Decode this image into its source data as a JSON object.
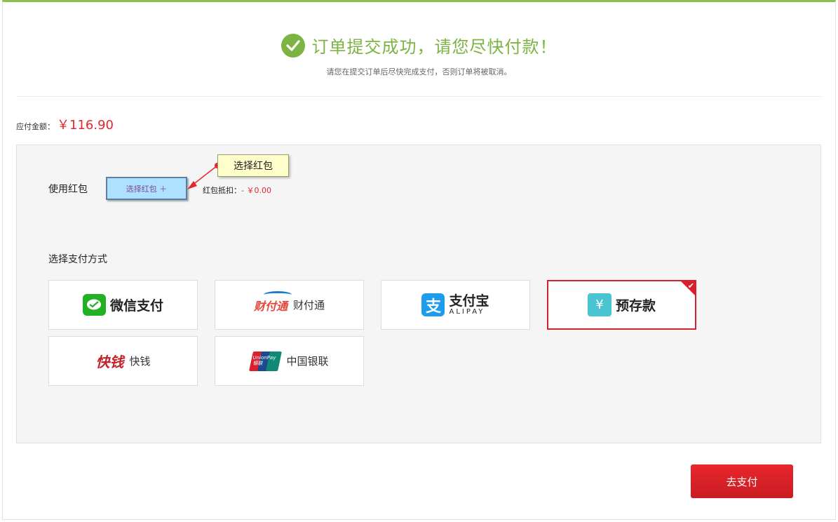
{
  "header": {
    "title": "订单提交成功，请您尽快付款！",
    "subtitle": "请您在提交订单后尽快完成支付，否则订单将被取消。"
  },
  "amount": {
    "label": "应付金额：",
    "value": "￥116.90"
  },
  "red_packet": {
    "label": "使用红包",
    "button": "选择红包 ＋",
    "deduct_label": "红包抵扣：",
    "deduct_value": "- ￥0.00",
    "tooltip": "选择红包"
  },
  "payment": {
    "label": "选择支付方式",
    "methods": [
      {
        "name": "微信支付",
        "icon": "wechat-pay-icon",
        "selected": false
      },
      {
        "name": "财付通",
        "logo_text": "财付通",
        "icon": "tenpay-logo",
        "selected": false
      },
      {
        "name": "支付宝",
        "sub": "ALIPAY",
        "icon": "alipay-icon",
        "selected": false
      },
      {
        "name": "预存款",
        "icon": "deposit-icon",
        "selected": true
      },
      {
        "name": "快钱",
        "logo_text": "快钱",
        "icon": "99bill-logo",
        "selected": false
      },
      {
        "name": "中国银联",
        "logo_text": "UnionPay 银联",
        "icon": "unionpay-logo",
        "selected": false
      }
    ]
  },
  "submit": {
    "label": "去支付"
  },
  "colors": {
    "success": "#7cb342",
    "price": "#e4262d",
    "selected_border": "#d9202d",
    "button": "#e4262d"
  }
}
